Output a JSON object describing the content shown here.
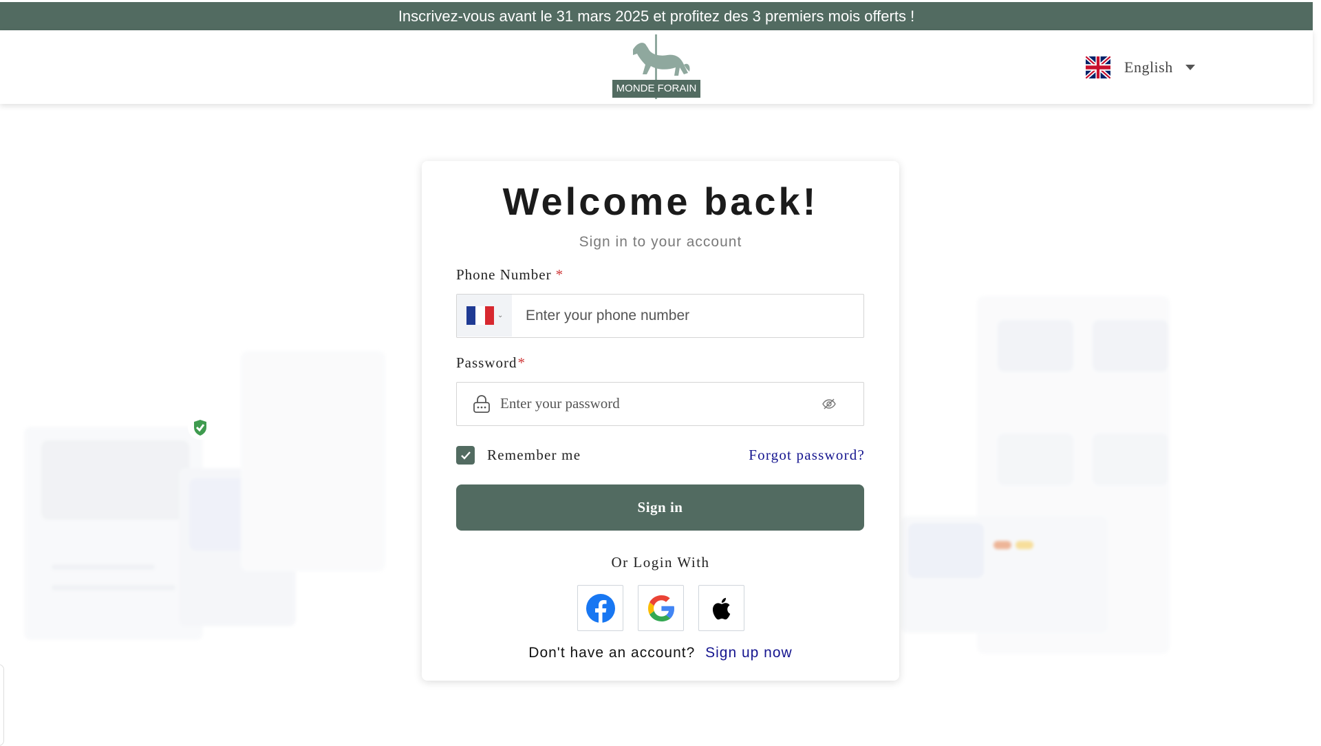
{
  "banner": {
    "text": "Inscrivez-vous avant le 31 mars 2025 et profitez des 3 premiers mois offerts !"
  },
  "header": {
    "logo_text": "MONDE FORAIN",
    "language": {
      "label": "English",
      "flag": "uk-flag-icon"
    }
  },
  "login": {
    "title": "Welcome back!",
    "subtitle": "Sign in to your account",
    "phone": {
      "label": "Phone Number",
      "required_mark": "*",
      "placeholder": "Enter your phone number",
      "value": "",
      "country_flag": "fr-flag-icon"
    },
    "password": {
      "label": "Password",
      "required_mark": "*",
      "placeholder": "Enter your password",
      "value": ""
    },
    "remember": {
      "label": "Remember me",
      "checked": true
    },
    "forgot_label": "Forgot password?",
    "submit_label": "Sign in",
    "or_label": "Or Login With",
    "social": [
      "facebook-icon",
      "google-icon",
      "apple-icon"
    ],
    "no_account_text": "Don't have an account?",
    "signup_label": "Sign up now"
  },
  "colors": {
    "brand": "#526b61",
    "link": "#15158f",
    "required": "#d0393a"
  }
}
